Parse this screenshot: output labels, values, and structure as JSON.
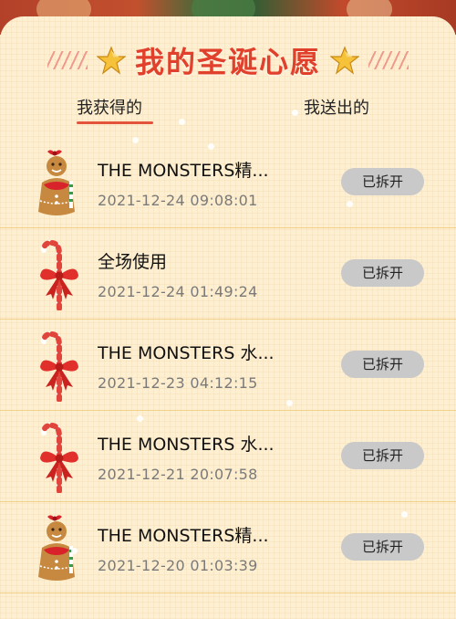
{
  "header": {
    "title": "我的圣诞心愿"
  },
  "tabs": [
    {
      "label": "我获得的",
      "active": true
    },
    {
      "label": "我送出的",
      "active": false
    }
  ],
  "items": [
    {
      "icon": "gingerbread-icon",
      "title": "THE MONSTERS精...",
      "time": "2021-12-24 09:08:01",
      "button": "已拆开"
    },
    {
      "icon": "candy-cane-icon",
      "title": "全场使用",
      "time": "2021-12-24 01:49:24",
      "button": "已拆开"
    },
    {
      "icon": "candy-cane-icon",
      "title": "THE MONSTERS 水...",
      "time": "2021-12-23 04:12:15",
      "button": "已拆开"
    },
    {
      "icon": "candy-cane-icon",
      "title": "THE MONSTERS 水...",
      "time": "2021-12-21 20:07:58",
      "button": "已拆开"
    },
    {
      "icon": "gingerbread-icon",
      "title": "THE MONSTERS精...",
      "time": "2021-12-20 01:03:39",
      "button": "已拆开"
    }
  ],
  "colors": {
    "accent": "#e4533c",
    "title": "#e0402c",
    "background": "#fdefd2",
    "button": "#c9c9c9"
  }
}
